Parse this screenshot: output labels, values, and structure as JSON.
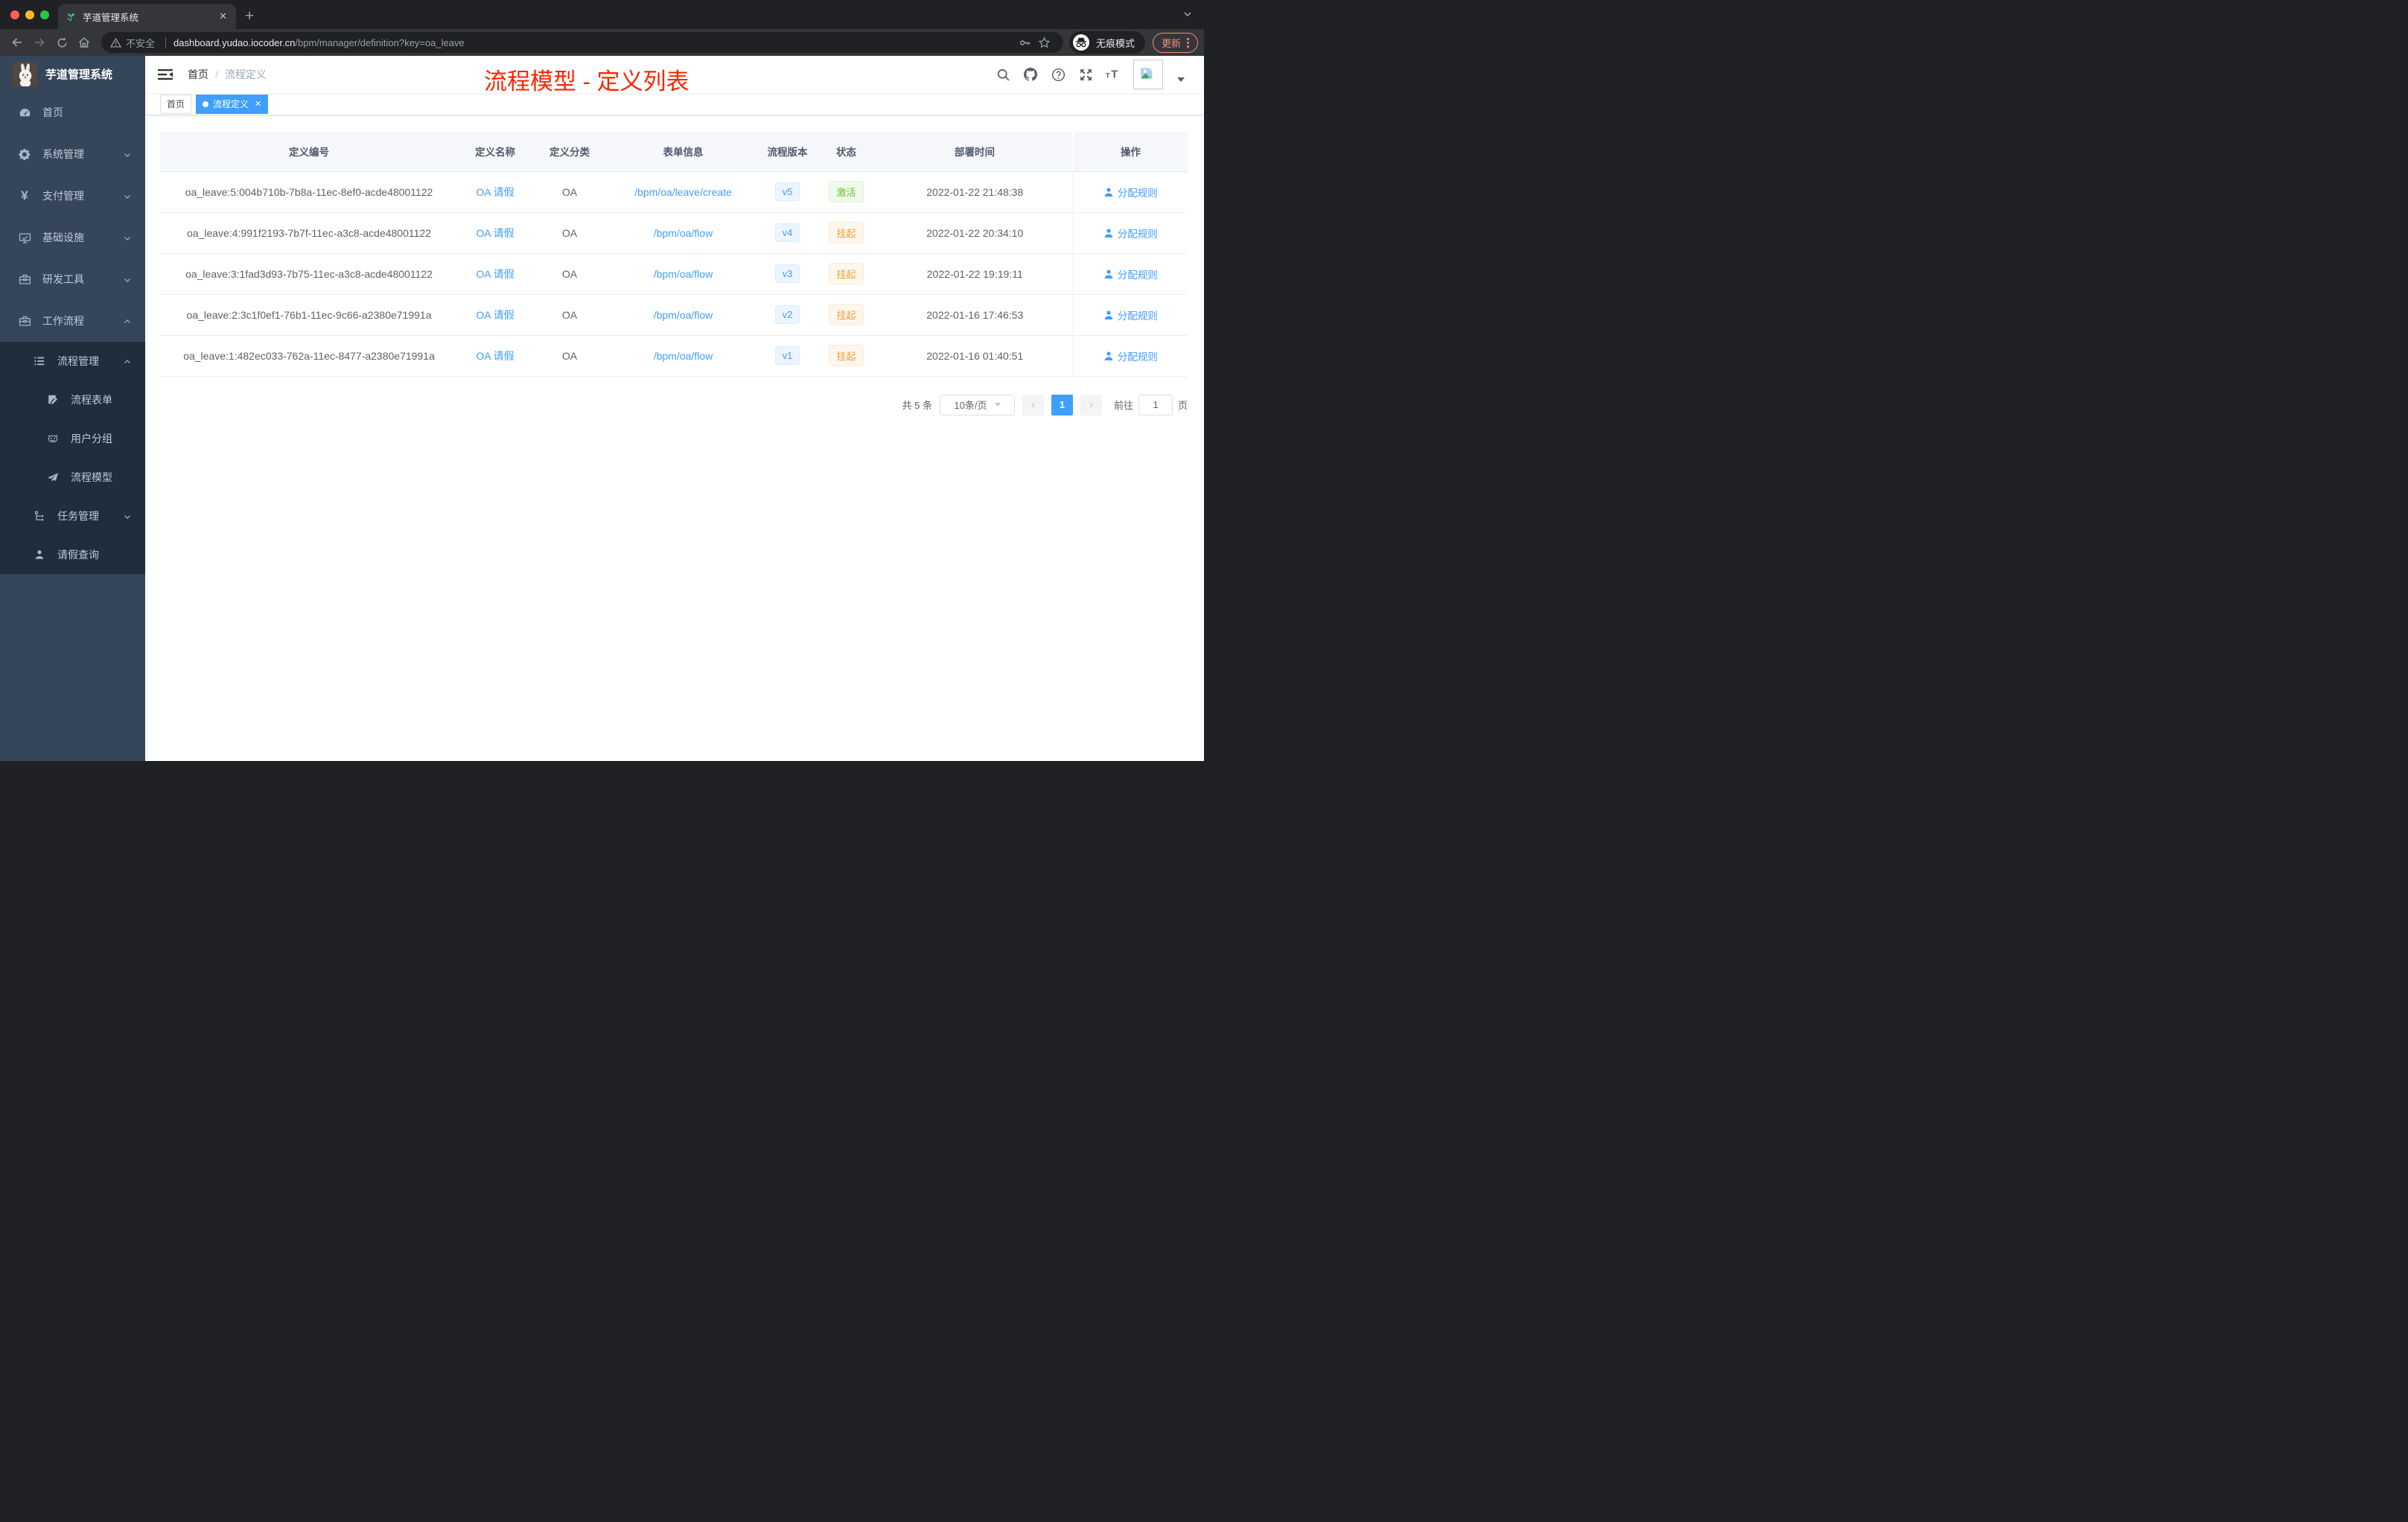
{
  "browser": {
    "tab": {
      "title": "芋道管理系统",
      "close_glyph": "✕",
      "new_tab_glyph": "+"
    },
    "address": {
      "security_text": "不安全",
      "url_domain": "dashboard.yudao.iocoder.cn",
      "url_path": "/bpm/manager/definition?key=oa_leave"
    },
    "incognito_label": "无痕模式",
    "update_label": "更新"
  },
  "sidebar": {
    "logo_title": "芋道管理系统",
    "items": [
      {
        "label": "首页",
        "icon": "dashboard-icon"
      },
      {
        "label": "系统管理",
        "icon": "gear-icon",
        "state": "collapsed"
      },
      {
        "label": "支付管理",
        "icon": "yen-icon",
        "state": "collapsed"
      },
      {
        "label": "基础设施",
        "icon": "monitor-icon",
        "state": "collapsed"
      },
      {
        "label": "研发工具",
        "icon": "toolbox-icon",
        "state": "collapsed"
      },
      {
        "label": "工作流程",
        "icon": "briefcase-icon",
        "state": "expanded",
        "children": [
          {
            "label": "流程管理",
            "icon": "list-icon",
            "state": "expanded",
            "children": [
              {
                "label": "流程表单",
                "icon": "form-icon"
              },
              {
                "label": "用户分组",
                "icon": "robot-icon"
              },
              {
                "label": "流程模型",
                "icon": "send-icon"
              }
            ]
          },
          {
            "label": "任务管理",
            "icon": "tree-icon",
            "state": "collapsed"
          },
          {
            "label": "请假查询",
            "icon": "user-icon"
          }
        ]
      }
    ],
    "yen_glyph": "¥"
  },
  "header": {
    "breadcrumb": {
      "home": "首页",
      "separator": "/",
      "current": "流程定义"
    },
    "annotation": "流程模型 - 定义列表"
  },
  "tags": [
    {
      "label": "首页",
      "active": false
    },
    {
      "label": "流程定义",
      "active": true,
      "close_glyph": "✕"
    }
  ],
  "table": {
    "columns": [
      "定义编号",
      "定义名称",
      "定义分类",
      "表单信息",
      "流程版本",
      "状态",
      "部署时间",
      "操作"
    ],
    "rows": [
      {
        "id": "oa_leave:5:004b710b-7b8a-11ec-8ef0-acde48001122",
        "name": "OA 请假",
        "category": "OA",
        "form": "/bpm/oa/leave/create",
        "version": "v5",
        "status": "激活",
        "status_type": "success",
        "deploy_time": "2022-01-22 21:48:38",
        "action": "分配规则"
      },
      {
        "id": "oa_leave:4:991f2193-7b7f-11ec-a3c8-acde48001122",
        "name": "OA 请假",
        "category": "OA",
        "form": "/bpm/oa/flow",
        "version": "v4",
        "status": "挂起",
        "status_type": "warning",
        "deploy_time": "2022-01-22 20:34:10",
        "action": "分配规则"
      },
      {
        "id": "oa_leave:3:1fad3d93-7b75-11ec-a3c8-acde48001122",
        "name": "OA 请假",
        "category": "OA",
        "form": "/bpm/oa/flow",
        "version": "v3",
        "status": "挂起",
        "status_type": "warning",
        "deploy_time": "2022-01-22 19:19:11",
        "action": "分配规则"
      },
      {
        "id": "oa_leave:2:3c1f0ef1-76b1-11ec-9c66-a2380e71991a",
        "name": "OA 请假",
        "category": "OA",
        "form": "/bpm/oa/flow",
        "version": "v2",
        "status": "挂起",
        "status_type": "warning",
        "deploy_time": "2022-01-16 17:46:53",
        "action": "分配规则"
      },
      {
        "id": "oa_leave:1:482ec033-762a-11ec-8477-a2380e71991a",
        "name": "OA 请假",
        "category": "OA",
        "form": "/bpm/oa/flow",
        "version": "v1",
        "status": "挂起",
        "status_type": "warning",
        "deploy_time": "2022-01-16 01:40:51",
        "action": "分配规则"
      }
    ]
  },
  "pagination": {
    "total_text": "共 5 条",
    "page_size": "10条/页",
    "prev_glyph": "‹",
    "current_page": "1",
    "next_glyph": "›",
    "goto_label": "前往",
    "goto_value": "1",
    "page_suffix": "页"
  },
  "colors": {
    "accent": "#409eff",
    "success": "#67c23a",
    "warning": "#e6a23c",
    "annotation_red": "#fe2400",
    "sidebar_bg": "#36465a",
    "submenu_bg": "#1f2d3d"
  }
}
